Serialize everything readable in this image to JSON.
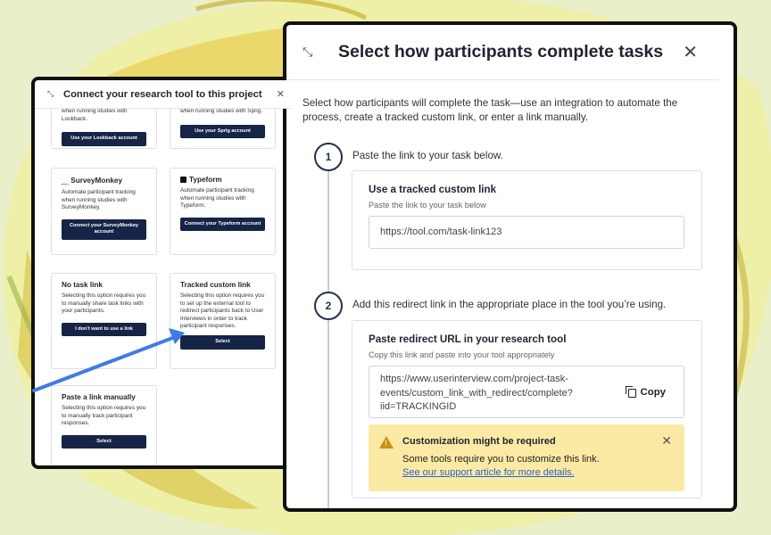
{
  "left_modal": {
    "title": "Connect your research tool to this project",
    "cards": {
      "lookback": {
        "partial_desc": "when running studies with Lookback.",
        "button": "Use your Lookback account"
      },
      "sprig": {
        "partial_desc": "when running studies with Sprig.",
        "button": "Use your Sprig account"
      },
      "surveymonkey": {
        "title": "SurveyMonkey",
        "desc": "Automate participant tracking when running studies with SurveyMonkey.",
        "button": "Connect your SurveyMonkey account"
      },
      "typeform": {
        "title": "Typeform",
        "desc": "Automate participant tracking when running studies with Typeform.",
        "button": "Connect your Typeform account"
      },
      "no_task_link": {
        "title": "No task link",
        "desc": "Selecting this option requires you to manually share task links with your participants.",
        "button": "I don't want to use a link"
      },
      "tracked_custom_link": {
        "title": "Tracked custom link",
        "desc": "Selecting this option requires you to set up the external tool to redirect participants back to User Interviews in order to track participant responses.",
        "button": "Select"
      },
      "paste_link": {
        "title": "Paste a link manually",
        "desc": "Selecting this option requires you to manually track participant responses.",
        "button": "Select"
      }
    }
  },
  "right_modal": {
    "title": "Select how participants complete tasks",
    "intro": "Select how participants will complete the task—use an integration to automate the process, create a tracked custom link, or enter a link manually.",
    "step1": {
      "number": "1",
      "text": "Paste the link to your task below.",
      "box_title": "Use a tracked custom link",
      "box_sub": "Paste the link to your task below",
      "field_value": "https://tool.com/task-link123"
    },
    "step2": {
      "number": "2",
      "text": "Add this redirect link in the appropriate place in the tool you’re using.",
      "box_title": "Paste redirect URL in your research tool",
      "box_sub": "Copy this link and paste into your tool appropriately",
      "url_line1": "https://www.userinterview.com/project-task-",
      "url_line2": "events/custom_link_with_redirect/complete?",
      "url_line3": "iid=TRACKINGID",
      "copy_label": "Copy"
    },
    "alert": {
      "title": "Customization might be required",
      "body": "Some tools require you to customize this link.",
      "link": "See our support article for more details."
    }
  },
  "colors": {
    "button_navy": "#152447",
    "alert_bg": "#fbeaa4",
    "link_blue": "#2a63c7",
    "arrow_blue": "#3d7be8"
  },
  "icons": [
    "expand-icon",
    "close-icon",
    "copy-icon",
    "warning-icon"
  ]
}
